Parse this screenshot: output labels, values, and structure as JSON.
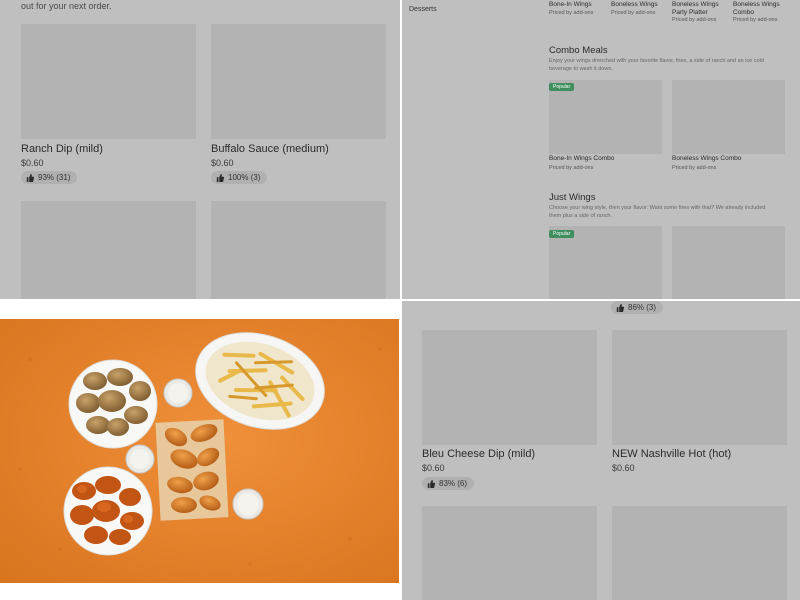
{
  "q1": {
    "top_text": "out for your next order.",
    "items": [
      {
        "name": "Ranch Dip (mild)",
        "price": "$0.60",
        "rating": "93% (31)"
      },
      {
        "name": "Buffalo Sauce (medium)",
        "price": "$0.60",
        "rating": "100% (3)"
      }
    ]
  },
  "q2": {
    "sidebar_category": "Desserts",
    "top_items": [
      {
        "name": "Bone-In Wings",
        "price": "Priced by add-ons"
      },
      {
        "name": "Boneless Wings",
        "price": "Priced by add-ons"
      },
      {
        "name": "Boneless Wings Party Platter",
        "price": "Priced by add-ons"
      },
      {
        "name": "Boneless Wings Combo",
        "price": "Priced by add-ons"
      }
    ],
    "combo": {
      "title": "Combo Meals",
      "description": "Enjoy your wings drenched with your favorite flavor, fries, a side of ranch and an ice cold beverage to wash it down.",
      "badge": "Popular",
      "items": [
        {
          "name": "Bone-In Wings Combo",
          "price": "Priced by add-ons"
        },
        {
          "name": "Boneless Wings Combo",
          "price": "Priced by add-ons"
        }
      ]
    },
    "just_wings": {
      "title": "Just Wings",
      "description": "Choose your wing style, then your flavor. Want some fries with that? We already included them plus a side of ranch.",
      "badge": "Popular"
    }
  },
  "q4": {
    "top_rating": "86% (3)",
    "items": [
      {
        "name": "Bleu Cheese Dip (mild)",
        "price": "$0.60",
        "rating": "83% (6)"
      },
      {
        "name": "NEW Nashville Hot (hot)",
        "price": "$0.60"
      }
    ]
  },
  "colors": {
    "overlay_gray": "#bfbfbf",
    "placeholder_gray": "#b3b3b3",
    "popular_green": "#3f8f5e",
    "hero_orange": "#e8872f"
  },
  "icons": [
    "thumbs-up-icon"
  ]
}
